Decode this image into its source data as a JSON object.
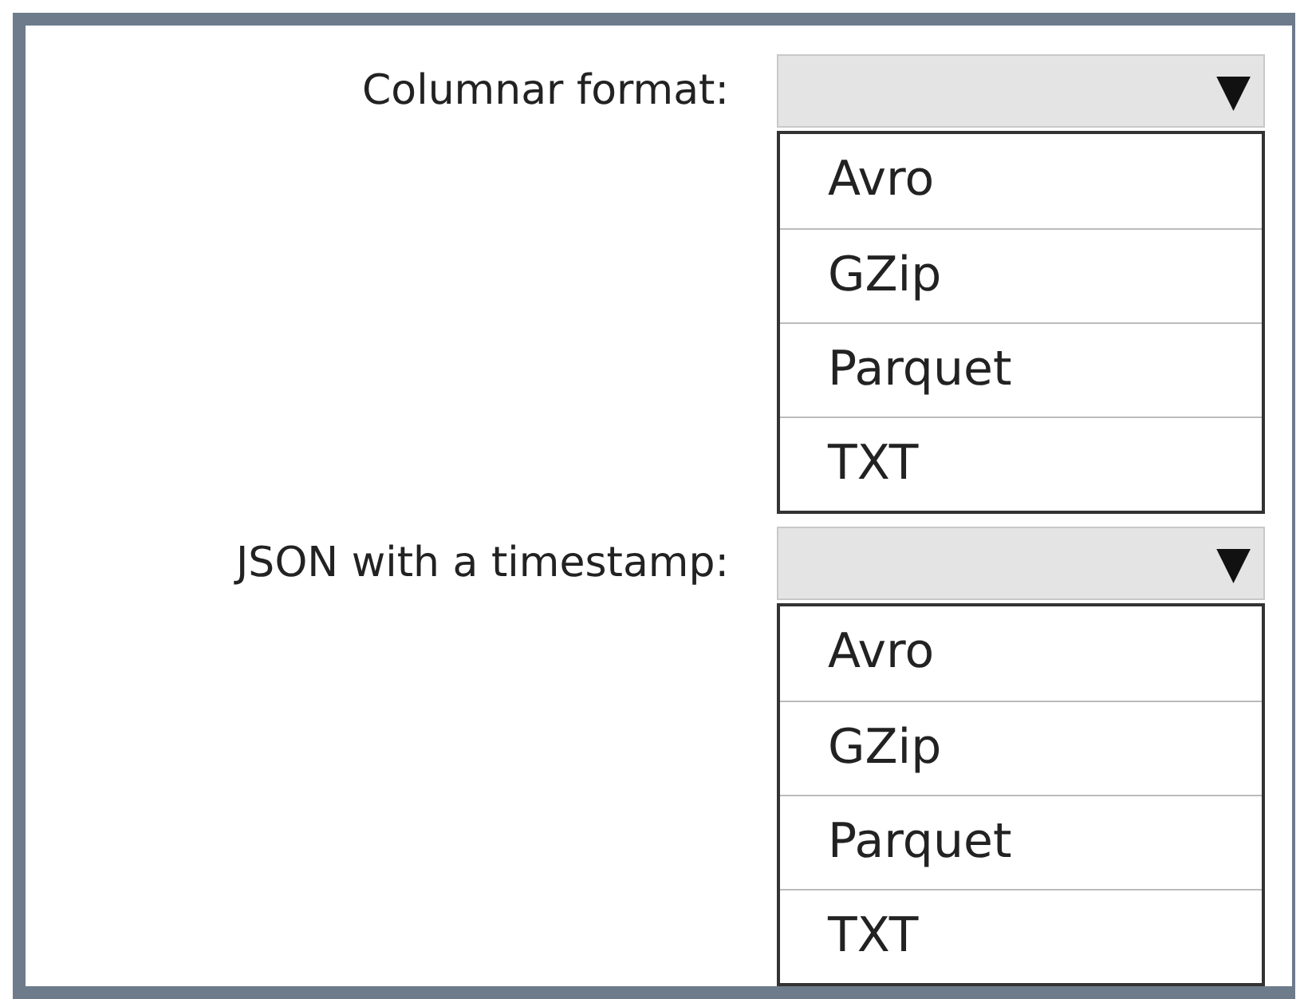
{
  "fields": [
    {
      "label": "Columnar format:",
      "arrow": "▼",
      "options": [
        "Avro",
        "GZip",
        "Parquet",
        "TXT"
      ]
    },
    {
      "label": "JSON with a timestamp:",
      "arrow": "▼",
      "options": [
        "Avro",
        "GZip",
        "Parquet",
        "TXT"
      ]
    }
  ]
}
